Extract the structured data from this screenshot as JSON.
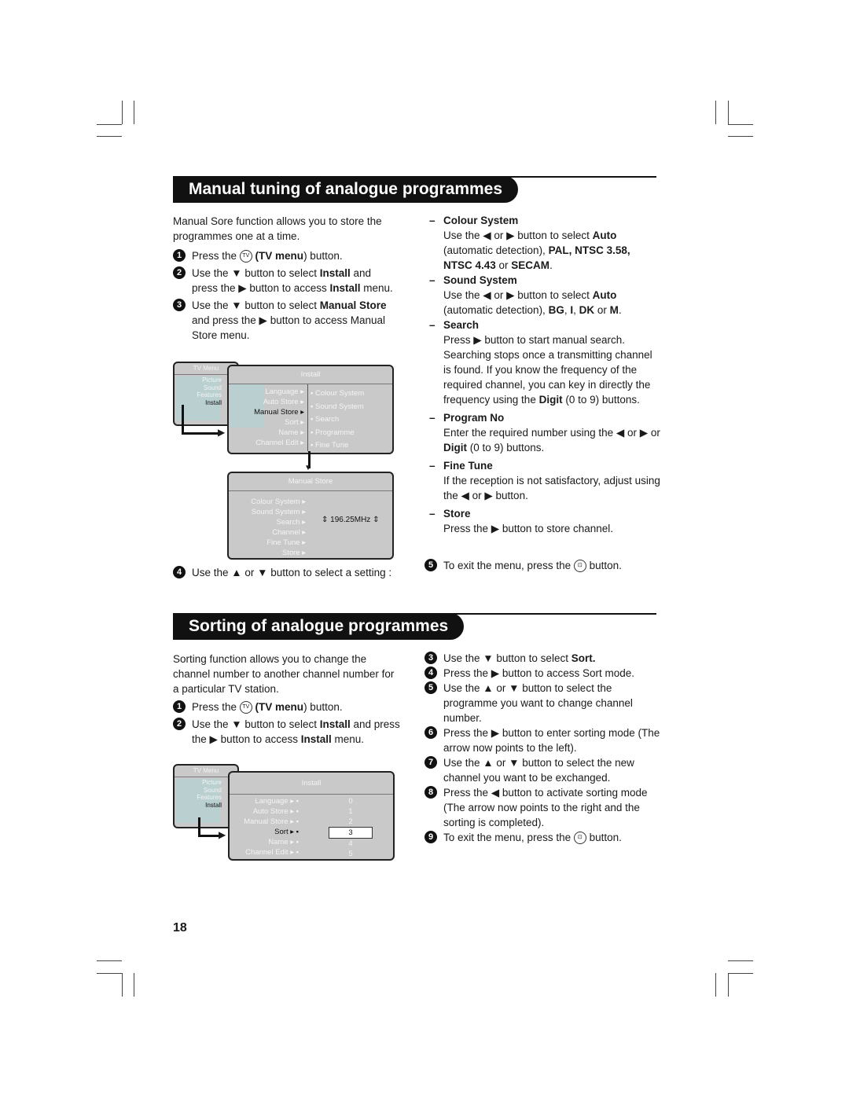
{
  "manual": {
    "title": "Manual tuning of analogue programmes",
    "intro": "Manual Sore function allows you to store the programmes one at a time.",
    "steps": [
      {
        "n": "1",
        "parts": [
          {
            "t": "Press the "
          },
          {
            "t": "TV",
            "icon": "menu-tv-button-icon"
          },
          {
            "t": " "
          },
          {
            "t": "(TV menu",
            "b": true
          },
          {
            "t": ") button."
          }
        ]
      },
      {
        "n": "2",
        "parts": [
          {
            "t": "Use the ▼ button to select "
          },
          {
            "t": "Install",
            "b": true
          },
          {
            "t": " and press the ▶ button to access "
          },
          {
            "t": "Install",
            "b": true
          },
          {
            "t": " menu."
          }
        ]
      },
      {
        "n": "3",
        "parts": [
          {
            "t": "Use the ▼ button to select "
          },
          {
            "t": "Manual Store",
            "b": true
          },
          {
            "t": " and press the ▶ button to access Manual Store menu."
          }
        ]
      }
    ],
    "step4": {
      "n": "4",
      "parts": [
        {
          "t": "Use the ▲ or ▼ button to select a setting :"
        }
      ]
    },
    "settings": [
      {
        "name": "Colour System",
        "parts": [
          {
            "t": "Use the ◀ or ▶ button to select "
          },
          {
            "t": "Auto",
            "b": true
          },
          {
            "t": " (automatic detection), "
          },
          {
            "t": "PAL, NTSC 3.58, NTSC 4.43",
            "b": true
          },
          {
            "t": " or "
          },
          {
            "t": "SECAM",
            "b": true
          },
          {
            "t": "."
          }
        ]
      },
      {
        "name": "Sound System",
        "parts": [
          {
            "t": "Use the ◀ or ▶ button to select "
          },
          {
            "t": "Auto",
            "b": true
          },
          {
            "t": " (automatic detection), "
          },
          {
            "t": "BG",
            "b": true
          },
          {
            "t": ", "
          },
          {
            "t": "I",
            "b": true
          },
          {
            "t": ", "
          },
          {
            "t": "DK",
            "b": true
          },
          {
            "t": " or "
          },
          {
            "t": "M",
            "b": true
          },
          {
            "t": "."
          }
        ]
      },
      {
        "name": "Search",
        "parts": [
          {
            "t": "Press ▶ button to start manual search. Searching stops once a transmitting channel is found. If you know the frequency of the required channel, you can key in directly the frequency using the "
          },
          {
            "t": "Digit",
            "b": true
          },
          {
            "t": " (0 to 9) buttons."
          }
        ]
      },
      {
        "name": "Program No",
        "parts": [
          {
            "t": "Enter the required number using the ◀ or ▶ or "
          },
          {
            "t": "Digit",
            "b": true
          },
          {
            "t": " (0 to 9) buttons."
          }
        ]
      },
      {
        "name": "Fine Tune",
        "parts": [
          {
            "t": "If the reception is not satisfactory, adjust using the ◀ or ▶ button."
          }
        ]
      },
      {
        "name": "Store",
        "parts": [
          {
            "t": "Press the ▶ button to store channel."
          }
        ]
      }
    ],
    "step5": {
      "n": "5",
      "parts": [
        {
          "t": "To exit the menu, press the "
        },
        {
          "t": "⊡",
          "icon": "exit-button-icon"
        },
        {
          "t": " button."
        }
      ]
    }
  },
  "sorting": {
    "title": "Sorting of analogue programmes",
    "intro": "Sorting function allows you to change the channel number to another channel number for a particular  TV station.",
    "steps": [
      {
        "n": "1",
        "parts": [
          {
            "t": "Press the "
          },
          {
            "t": "TV",
            "icon": "menu-tv-button-icon"
          },
          {
            "t": " "
          },
          {
            "t": "(TV menu",
            "b": true
          },
          {
            "t": ") button."
          }
        ]
      },
      {
        "n": "2",
        "parts": [
          {
            "t": "Use the ▼ button to select "
          },
          {
            "t": "Install",
            "b": true
          },
          {
            "t": " and press the ▶ button to access "
          },
          {
            "t": "Install",
            "b": true
          },
          {
            "t": "  menu."
          }
        ]
      }
    ],
    "steps_right": [
      {
        "n": "3",
        "parts": [
          {
            "t": "Use the ▼ button to select "
          },
          {
            "t": "Sort.",
            "b": true
          }
        ]
      },
      {
        "n": "4",
        "parts": [
          {
            "t": "Press the ▶ button to access Sort mode."
          }
        ]
      },
      {
        "n": "5",
        "parts": [
          {
            "t": "Use the ▲ or ▼ button to select the programme you want to change channel number."
          }
        ]
      },
      {
        "n": "6",
        "parts": [
          {
            "t": "Press the ▶ button to enter sorting mode (The arrow now points to the left)."
          }
        ]
      },
      {
        "n": "7",
        "parts": [
          {
            "t": "Use the ▲ or ▼ button to select the new channel you want to be exchanged."
          }
        ]
      },
      {
        "n": "8",
        "parts": [
          {
            "t": "Press the ◀ button to activate sorting mode (The arrow now points to the right and the sorting is completed)."
          }
        ]
      },
      {
        "n": "9",
        "parts": [
          {
            "t": "To exit the menu, press the "
          },
          {
            "t": "⊡",
            "icon": "exit-button-icon"
          },
          {
            "t": " button."
          }
        ]
      }
    ]
  },
  "menus": {
    "tv_menu": {
      "title": "TV Menu",
      "items": [
        "Picture",
        "Sound",
        "Features",
        "Install"
      ]
    },
    "install": {
      "title": "Install",
      "items": [
        "Language",
        "Auto Store",
        "Manual Store",
        "Sort",
        "Name",
        "Channel Edit"
      ],
      "sub": [
        "Colour System",
        "Sound System",
        "Search",
        "Programme",
        "Fine Tune"
      ]
    },
    "manual_store": {
      "title": "Manual Store",
      "items": [
        "Colour System",
        "Sound System",
        "Search",
        "Channel",
        "Fine Tune",
        "Store"
      ],
      "frequency": "196.25MHz"
    },
    "sort_values": [
      "0",
      "1",
      "2",
      "3",
      "4",
      "5"
    ]
  },
  "page_number": "18"
}
